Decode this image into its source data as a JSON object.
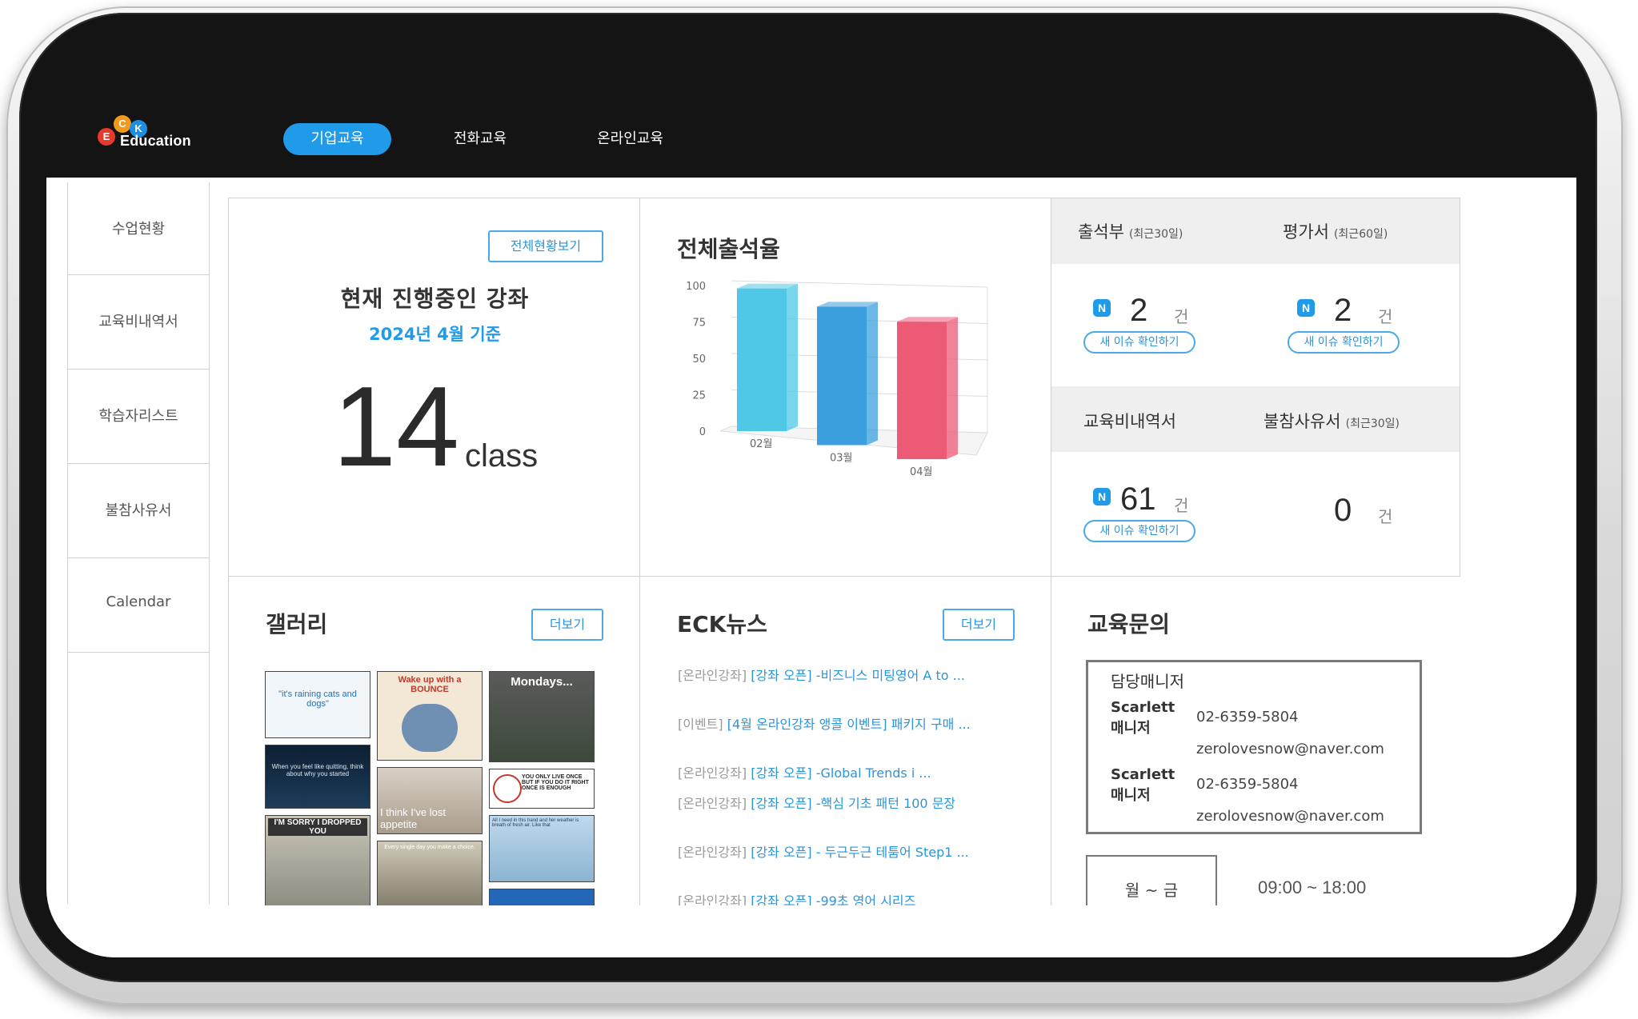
{
  "brand": {
    "logo_letters": [
      "E",
      "C",
      "K"
    ],
    "logo_text": "Education"
  },
  "nav": {
    "tabs": [
      {
        "label": "기업교육",
        "active": true
      },
      {
        "label": "전화교육",
        "active": false
      },
      {
        "label": "온라인교육",
        "active": false
      }
    ]
  },
  "sidebar": {
    "items": [
      {
        "label": "수업현황"
      },
      {
        "label": "교육비내역서"
      },
      {
        "label": "학습자리스트"
      },
      {
        "label": "불참사유서"
      },
      {
        "label": "Calendar"
      }
    ]
  },
  "current_courses": {
    "view_all_button": "전체현황보기",
    "title": "현재 진행중인 강좌",
    "subtitle": "2024년 4월 기준",
    "count": "14",
    "unit": "class"
  },
  "attendance": {
    "title": "전체출석율",
    "chart_data": {
      "type": "bar",
      "title": "전체출석율",
      "categories": [
        "02월",
        "03월",
        "04월"
      ],
      "values": [
        98,
        95,
        93
      ],
      "ylim": [
        0,
        100
      ],
      "yticks": [
        "100",
        "75",
        "50",
        "25",
        "0"
      ],
      "colors": [
        "#4ec8e6",
        "#3a9fdc",
        "#ec5a75"
      ],
      "grid": true
    }
  },
  "stats": {
    "attendance_book": {
      "label": "출석부",
      "period": "(최근30일)",
      "badge": "N",
      "count": "2",
      "unit": "건",
      "button": "새 이슈 확인하기"
    },
    "evaluation": {
      "label": "평가서",
      "period": "(최근60일)",
      "badge": "N",
      "count": "2",
      "unit": "건",
      "button": "새 이슈 확인하기"
    },
    "fee_statement": {
      "label": "교육비내역서",
      "badge": "N",
      "count": "61",
      "unit": "건",
      "button": "새 이슈 확인하기"
    },
    "absence": {
      "label": "불참사유서",
      "period": "(최근30일)",
      "count": "0",
      "unit": "건"
    }
  },
  "gallery": {
    "title": "갤러리",
    "more_button": "더보기",
    "thumbs": [
      "\"it's raining cats and dogs\"",
      "Wake up with a BOUNCE",
      "Mondays...",
      "When you feel like quitting, think about why you started",
      "I think I've lost appetite",
      "YOU ONLY LIVE ONCE BUT IF YOU DO IT RIGHT ONCE IS ENOUGH",
      "I'M SORRY I DROPPED YOU",
      "Every single day you make a choice.",
      "All I need in this hand and her weather is breath of fresh air. Like that"
    ]
  },
  "news": {
    "title": "ECK뉴스",
    "more_button": "더보기",
    "items": [
      {
        "category": "[온라인강좌]",
        "text": "[강좌 오픈] -비즈니스 미팅영어 A to ..."
      },
      {
        "category": "[이벤트]",
        "text": "[4월 온라인강좌 앵콜 이벤트] 패키지 구매 ..."
      },
      {
        "category": "[온라인강좌]",
        "text": "[강좌 오픈] -Global Trends i ..."
      },
      {
        "category": "[온라인강좌]",
        "text": "[강좌 오픈] -핵심 기초 패턴 100 문장"
      },
      {
        "category": "[온라인강좌]",
        "text": "[강좌 오픈] - 두근두근 테툼어 Step1 ..."
      },
      {
        "category": "[온라인강좌]",
        "text": "[강좌 오픈] -99초 영어 시리즈"
      }
    ]
  },
  "inquiry": {
    "title": "교육문의",
    "manager_heading": "담당매니저",
    "managers": [
      {
        "name": "Scarlett 매니저",
        "phone": "02-6359-5804",
        "email": "zerolovesnow@naver.com"
      },
      {
        "name": "Scarlett 매니저",
        "phone": "02-6359-5804",
        "email": "zerolovesnow@naver.com"
      }
    ],
    "hours_days": "월 ~ 금",
    "hours_time": "09:00 ~ 18:00"
  }
}
